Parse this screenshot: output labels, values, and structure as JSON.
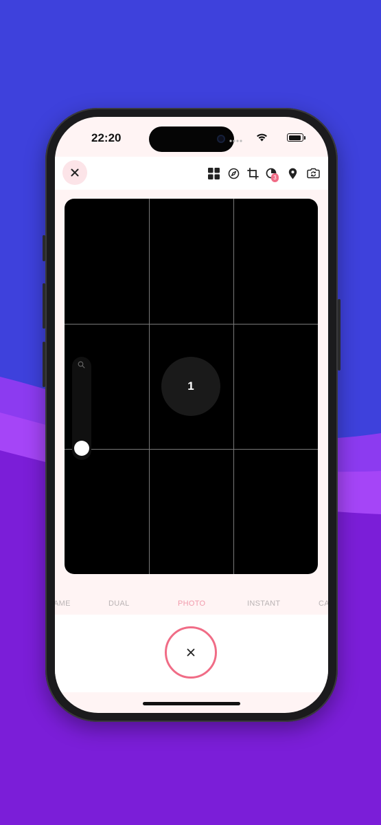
{
  "status_bar": {
    "time": "22:20"
  },
  "toolbar": {
    "close_icon": "close-icon",
    "icons": [
      "layout-grid-icon",
      "compass-icon",
      "crop-icon",
      "timer-icon",
      "location-pin-icon",
      "switch-camera-icon"
    ],
    "timer_badge": "3"
  },
  "viewfinder": {
    "countdown": "1",
    "zoom_icon": "search-icon",
    "zoom_level": 0
  },
  "modes": {
    "items": [
      "AME",
      "DUAL",
      "PHOTO",
      "INSTANT",
      "CA"
    ],
    "active": "PHOTO"
  },
  "shutter": {
    "icon": "close-icon"
  },
  "colors": {
    "background": "#3E41DC",
    "accent": "#F06C86",
    "active_mode": "#F29BAC"
  }
}
